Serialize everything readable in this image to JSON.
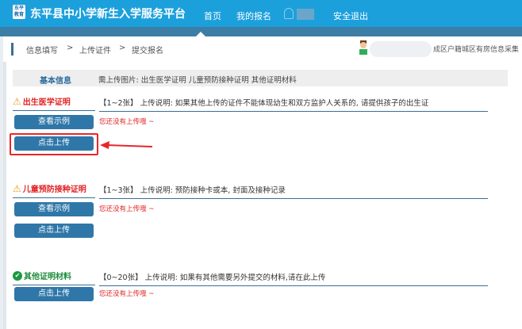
{
  "header": {
    "logo_text": "东平教育",
    "title": "东平县中小学新生入学服务平台",
    "nav": [
      {
        "label": "首页"
      },
      {
        "label": "我的报名"
      },
      {
        "label": "安全退出"
      }
    ]
  },
  "breadcrumb": {
    "items": [
      "信息填写",
      "上传证件",
      "提交报名"
    ],
    "separator": ">",
    "right_text": "成区户籍城区有房信息采集"
  },
  "info": {
    "label": "基本信息",
    "required": "需上传图片:  出生医学证明   儿童预防接种证明   其他证明材料"
  },
  "sections": [
    {
      "title": "出生医学证明",
      "status": "warning",
      "desc": "【1~2张】 上传说明: 如果其他上传的证件不能体现幼生和双方监护人关系的, 请提供孩子的出生证",
      "example_label": "查看示例",
      "upload_label": "点击上传",
      "empty_text": "您还没有上传哦 ~"
    },
    {
      "title": "儿童预防接种证明",
      "status": "warning",
      "desc": "【1~3张】 上传说明: 预防接种卡或本, 封面及接种记录",
      "example_label": "查看示例",
      "upload_label": "点击上传",
      "empty_text": "您还没有上传哦 ~"
    },
    {
      "title": "其他证明材料",
      "status": "ok",
      "desc": "【0~20张】 上传说明: 如果有其他需要另外提交的材料,请在此上传",
      "upload_label": "点击上传",
      "empty_text": "您还没有上传哦 ~"
    }
  ],
  "colors": {
    "topbar": "#1ca0dc",
    "button": "#2f77a8",
    "warning": "#e02424",
    "highlight": "#e8262a"
  }
}
